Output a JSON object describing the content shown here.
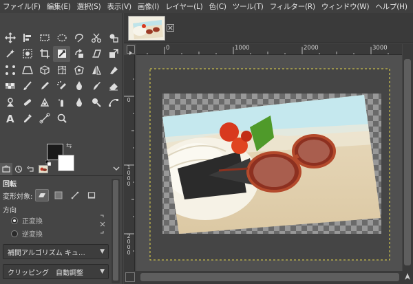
{
  "menubar": {
    "items": [
      "ファイル(F)",
      "編集(E)",
      "選択(S)",
      "表示(V)",
      "画像(I)",
      "レイヤー(L)",
      "色(C)",
      "ツール(T)",
      "フィルター(R)",
      "ウィンドウ(W)",
      "ヘルプ(H)"
    ]
  },
  "tools": [
    "move-icon",
    "align-icon",
    "rect-select-icon",
    "ellipse-select-icon",
    "free-select-icon",
    "scissors-select-icon",
    "foreground-select-icon",
    "fuzzy-select-icon",
    "color-select-icon",
    "crop-icon",
    "unified-transform-icon",
    "rotate-icon",
    "shear-icon",
    "scale-icon",
    "handle-transform-icon",
    "perspective-icon",
    "3d-transform-icon",
    "warp-icon",
    "cage-icon",
    "flip-icon",
    "seamless-clone-icon",
    "gradient-icon",
    "paintbrush-icon",
    "pencil-icon",
    "airbrush-icon",
    "ink-icon",
    "mypaint-brush-icon",
    "eraser-icon",
    "clone-icon",
    "heal-icon",
    "perspective-clone-icon",
    "smudge-icon",
    "blur-icon",
    "dodge-burn-icon",
    "paths-icon",
    "text-icon",
    "color-picker-icon",
    "measure-icon",
    "zoom-icon",
    "",
    "",
    ""
  ],
  "colors": {
    "foreground": "#1a1a1a",
    "background": "#ffffff",
    "guide": "#e6d94a"
  },
  "tool_options": {
    "title": "回転",
    "transform_label": "変形対象:",
    "direction_label": "方向",
    "direction_options": [
      "正変換",
      "逆変換"
    ],
    "interpolation_label": "補間アルゴリズム キュ…",
    "clipping_label": "クリッピング",
    "clipping_value": "自動調整"
  },
  "ruler": {
    "h_labels": [
      "0",
      "1000",
      "2000",
      "3000"
    ],
    "v_labels": [
      [
        "0"
      ],
      [
        "1",
        "0",
        "0",
        "0"
      ],
      [
        "2",
        "0",
        "0",
        "0"
      ]
    ]
  }
}
